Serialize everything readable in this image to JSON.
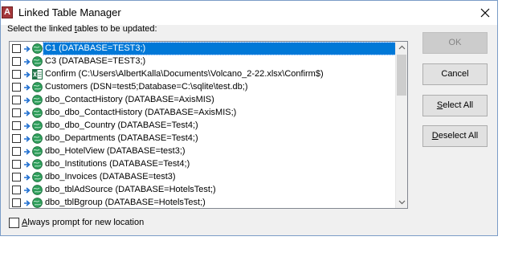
{
  "window": {
    "title": "Linked Table Manager",
    "app_icon_letter": "A"
  },
  "prompt": {
    "prefix": "Select the linked ",
    "accel": "t",
    "suffix": "ables to be updated:"
  },
  "tables": [
    {
      "label": "C1   (DATABASE=TEST3;)",
      "icon": "globe-icon",
      "selected": true
    },
    {
      "label": "C3   (DATABASE=TEST3;)",
      "icon": "globe-icon",
      "selected": false
    },
    {
      "label": "Confirm   (C:\\Users\\AlbertKalla\\Documents\\Volcano_2-22.xlsx\\Confirm$)",
      "icon": "excel-icon",
      "selected": false
    },
    {
      "label": "Customers   (DSN=test5;Database=C:\\sqlite\\test.db;)",
      "icon": "globe-icon",
      "selected": false
    },
    {
      "label": "dbo_ContactHistory   (DATABASE=AxisMIS)",
      "icon": "globe-icon",
      "selected": false
    },
    {
      "label": "dbo_dbo_ContactHistory   (DATABASE=AxisMIS;)",
      "icon": "globe-icon",
      "selected": false
    },
    {
      "label": "dbo_dbo_Country   (DATABASE=Test4;)",
      "icon": "globe-icon",
      "selected": false
    },
    {
      "label": "dbo_Departments   (DATABASE=Test4;)",
      "icon": "globe-icon",
      "selected": false
    },
    {
      "label": "dbo_HotelView   (DATABASE=test3;)",
      "icon": "globe-icon",
      "selected": false
    },
    {
      "label": "dbo_Institutions   (DATABASE=Test4;)",
      "icon": "globe-icon",
      "selected": false
    },
    {
      "label": "dbo_Invoices   (DATABASE=test3)",
      "icon": "globe-icon",
      "selected": false
    },
    {
      "label": "dbo_tblAdSource   (DATABASE=HotelsTest;)",
      "icon": "globe-icon",
      "selected": false
    },
    {
      "label": "dbo_tblBgroup   (DATABASE=HotelsTest;)",
      "icon": "globe-icon",
      "selected": false
    }
  ],
  "buttons": {
    "ok": {
      "label": "OK",
      "accel": "",
      "disabled": true
    },
    "cancel": {
      "label": "Cancel",
      "accel": "",
      "disabled": false
    },
    "select_all": {
      "accel": "S",
      "rest": "elect All"
    },
    "deselect_all": {
      "accel": "D",
      "rest": "eselect All"
    }
  },
  "always_prompt": {
    "accel": "A",
    "rest": "lways prompt for new location",
    "checked": false
  },
  "colors": {
    "selection": "#0078d7",
    "app_icon": "#a4373a",
    "globe": "#2e9d5a",
    "arrow": "#1f6fd1"
  }
}
